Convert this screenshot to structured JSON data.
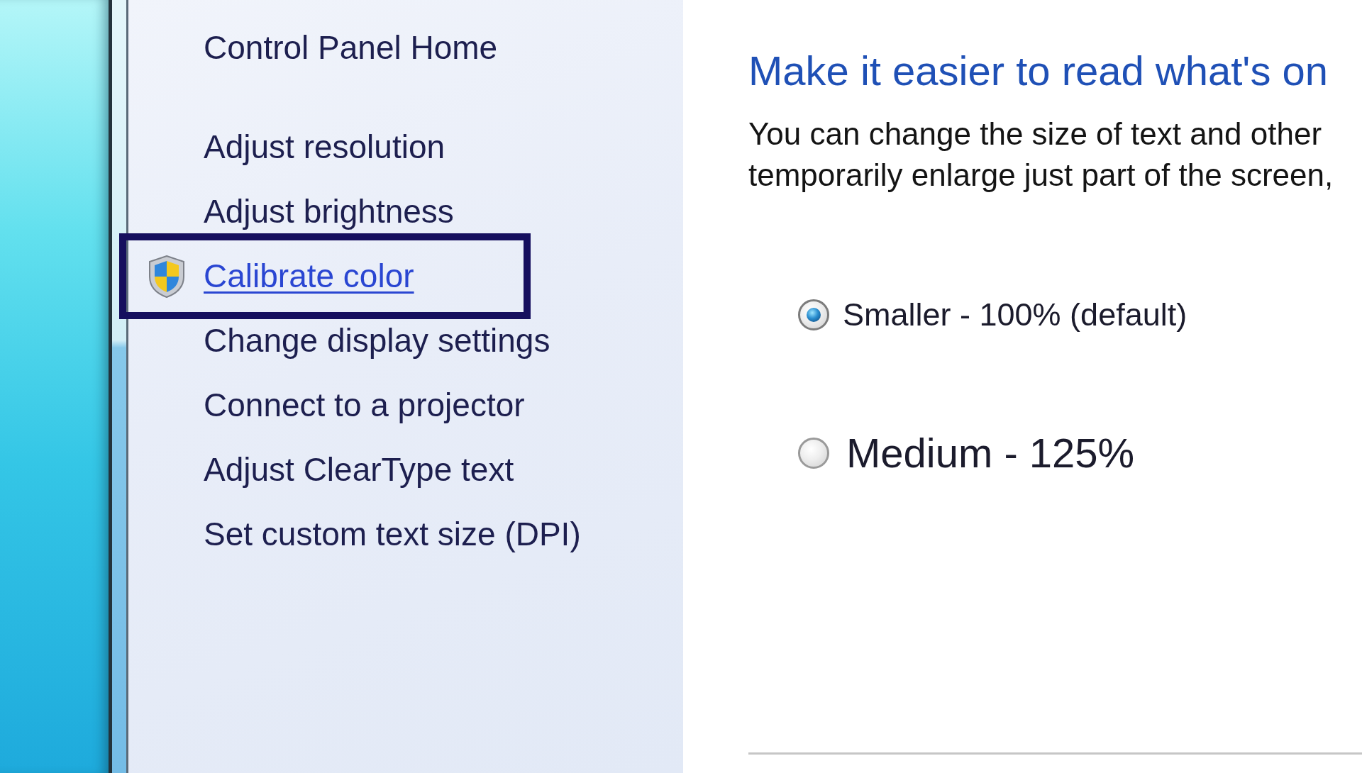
{
  "sidebar": {
    "home_link": {
      "label": "Control Panel Home"
    },
    "items": [
      {
        "label": "Adjust resolution",
        "kind": "plain",
        "hovered": false,
        "highlighted": false
      },
      {
        "label": "Adjust brightness",
        "kind": "plain",
        "hovered": false,
        "highlighted": false
      },
      {
        "label": "Calibrate color",
        "kind": "elevated",
        "hovered": true,
        "highlighted": true
      },
      {
        "label": "Change display settings",
        "kind": "plain",
        "hovered": false,
        "highlighted": false
      },
      {
        "label": "Connect to a projector",
        "kind": "plain",
        "hovered": false,
        "highlighted": false
      },
      {
        "label": "Adjust ClearType text",
        "kind": "plain",
        "hovered": false,
        "highlighted": false
      },
      {
        "label": "Set custom text size (DPI)",
        "kind": "plain",
        "hovered": false,
        "highlighted": false
      }
    ]
  },
  "content": {
    "heading": "Make it easier to read what's on",
    "description_lines": [
      "You can change the size of text and other",
      "temporarily enlarge just part of the screen,"
    ],
    "options": [
      {
        "label": "Smaller - 100% (default)",
        "kind": "small",
        "selected": true
      },
      {
        "label": "Medium - 125%",
        "kind": "medium",
        "selected": false
      }
    ]
  }
}
